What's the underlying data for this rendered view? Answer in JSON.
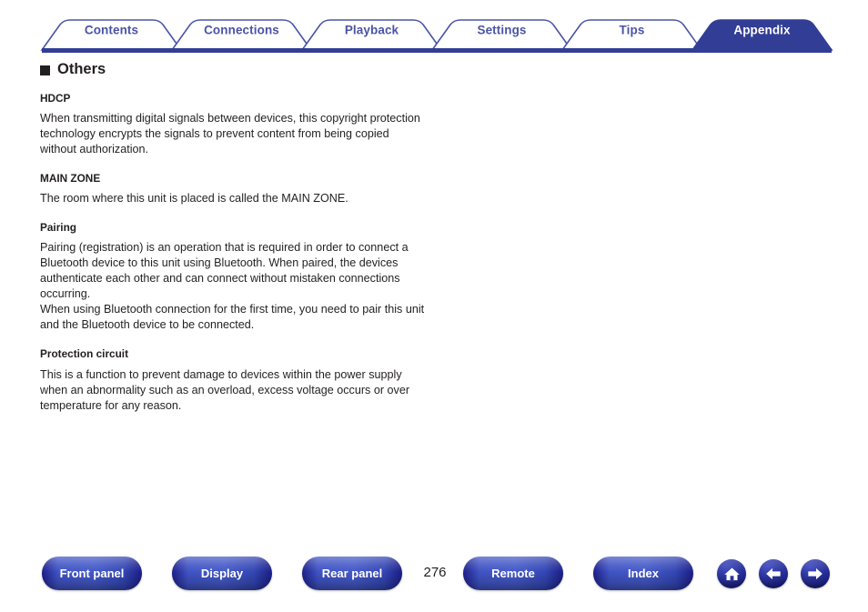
{
  "tabs": {
    "items": [
      {
        "label": "Contents",
        "active": false
      },
      {
        "label": "Connections",
        "active": false
      },
      {
        "label": "Playback",
        "active": false
      },
      {
        "label": "Settings",
        "active": false
      },
      {
        "label": "Tips",
        "active": false
      },
      {
        "label": "Appendix",
        "active": true
      }
    ],
    "active_color": "#323e95",
    "inactive_text_color": "#4a54a6",
    "outline_color": "#4a54a6",
    "rule_color": "#323e95"
  },
  "main": {
    "section_title": "Others",
    "bullet_icon": "filled-square-bullet",
    "entries": [
      {
        "term": "HDCP",
        "description": "When transmitting digital signals between devices, this copyright protection technology encrypts the signals to prevent content from being copied without authorization."
      },
      {
        "term": "MAIN ZONE",
        "description": "The room where this unit is placed is called the MAIN ZONE."
      },
      {
        "term": "Pairing",
        "description": "Pairing (registration) is an operation that is required in order to connect a Bluetooth device to this unit using Bluetooth. When paired, the devices authenticate each other and can connect without mistaken connections occurring.\nWhen using Bluetooth connection for the first time, you need to pair this unit and the Bluetooth device to be connected."
      },
      {
        "term": "Protection circuit",
        "description": "This is a function to prevent damage to devices within the power supply when an abnormality such as an overload, excess voltage occurs or over temperature for any reason."
      }
    ]
  },
  "footer": {
    "buttons": [
      {
        "label": "Front panel",
        "name": "front-panel-button"
      },
      {
        "label": "Display",
        "name": "display-button"
      },
      {
        "label": "Rear panel",
        "name": "rear-panel-button"
      },
      {
        "label": "Remote",
        "name": "remote-button"
      },
      {
        "label": "Index",
        "name": "index-button"
      }
    ],
    "page_number": "276",
    "icons": [
      {
        "name": "home-icon",
        "glyph": "home"
      },
      {
        "name": "arrow-left-icon",
        "glyph": "left"
      },
      {
        "name": "arrow-right-icon",
        "glyph": "right"
      }
    ],
    "button_color": "#3f53c4"
  }
}
